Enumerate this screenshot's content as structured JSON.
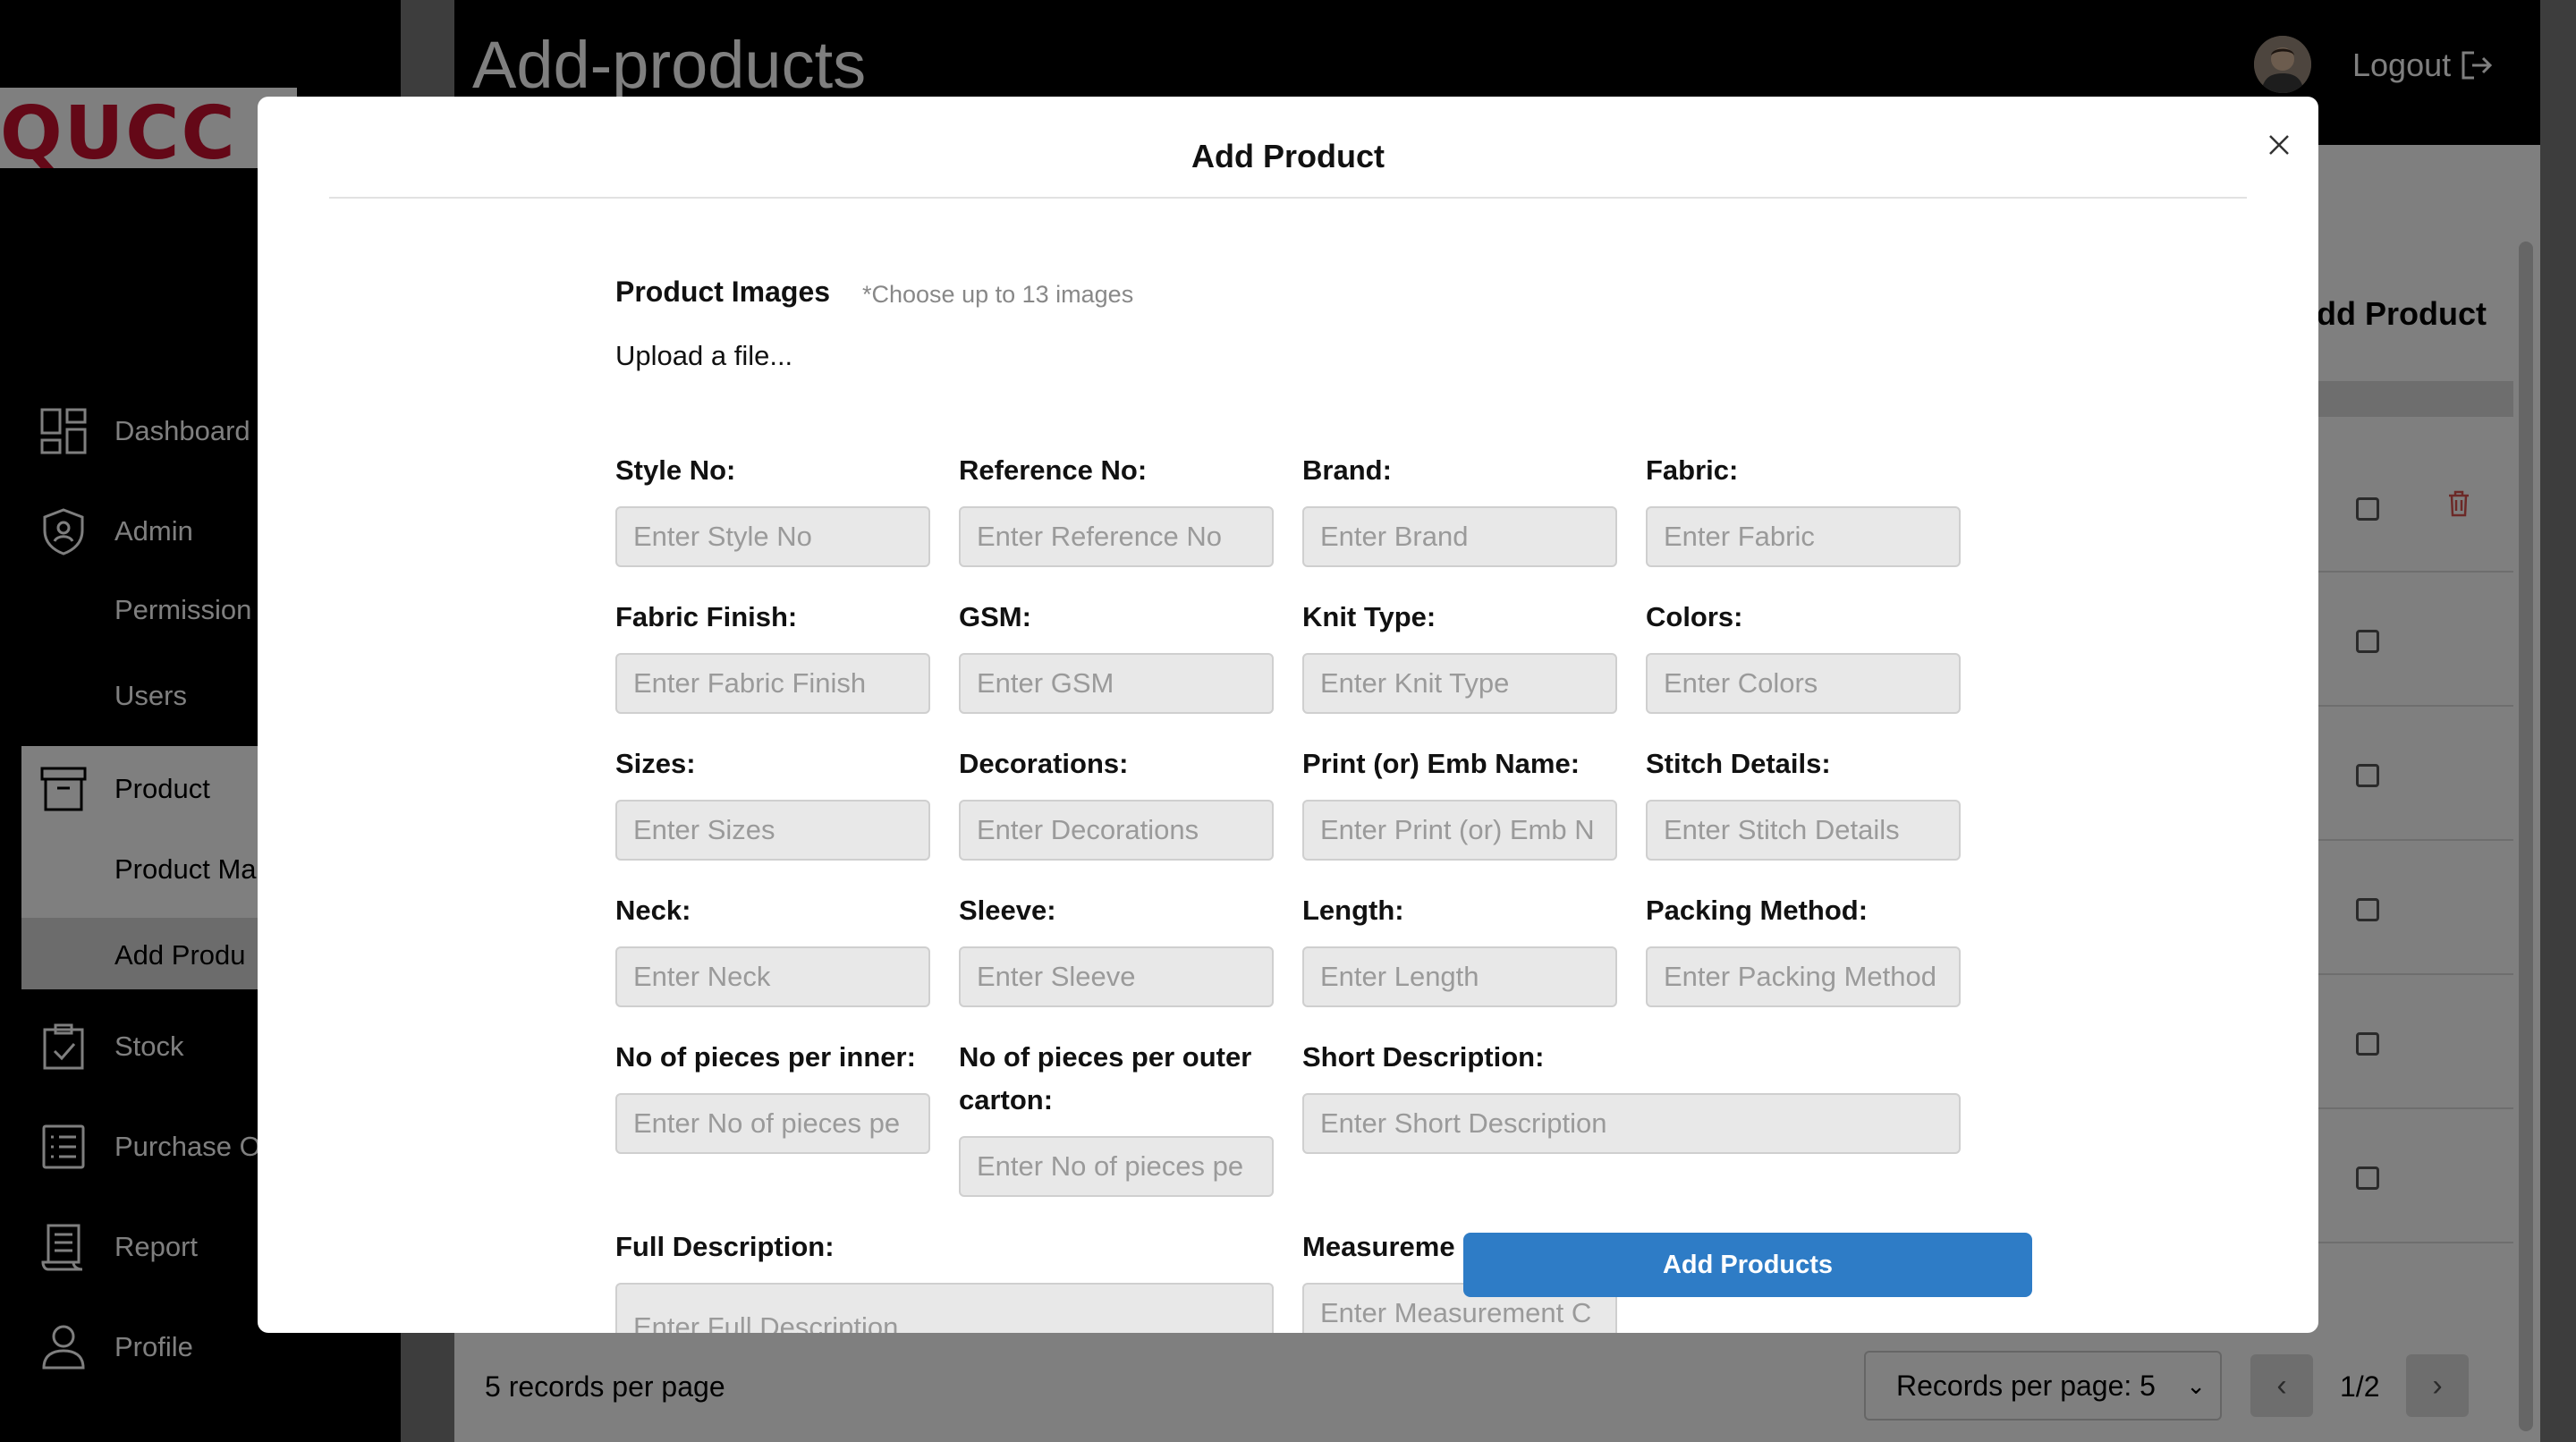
{
  "app": {
    "logo_text": "QUCC",
    "page_title": "Add-products",
    "logout_label": "Logout"
  },
  "sidebar": {
    "items": [
      {
        "label": "Dashboard",
        "icon": "dashboard-icon"
      },
      {
        "label": "Admin",
        "icon": "shield-icon"
      },
      {
        "label": "Permission",
        "icon": ""
      },
      {
        "label": "Users",
        "icon": ""
      },
      {
        "label": "Product",
        "icon": "archive-icon"
      },
      {
        "label": "Product Ma",
        "icon": ""
      },
      {
        "label": "Add Produ",
        "icon": ""
      },
      {
        "label": "Stock",
        "icon": "clipboard-check-icon"
      },
      {
        "label": "Purchase O",
        "icon": "list-icon"
      },
      {
        "label": "Report",
        "icon": "receipt-icon"
      },
      {
        "label": "Profile",
        "icon": "user-icon"
      }
    ]
  },
  "background": {
    "panel_title": "dd Product",
    "records_text": "5 records per page",
    "records_select": "Records per page: 5",
    "page_indicator": "1/2"
  },
  "modal": {
    "title": "Add Product",
    "images_label": "Product Images",
    "images_hint": "*Choose up to 13 images",
    "upload_text": "Upload a file...",
    "fields": [
      {
        "label": "Style No:",
        "placeholder": "Enter Style No"
      },
      {
        "label": "Reference No:",
        "placeholder": "Enter Reference No"
      },
      {
        "label": "Brand:",
        "placeholder": "Enter Brand"
      },
      {
        "label": "Fabric:",
        "placeholder": "Enter Fabric"
      },
      {
        "label": "Fabric Finish:",
        "placeholder": "Enter Fabric Finish"
      },
      {
        "label": "GSM:",
        "placeholder": "Enter GSM"
      },
      {
        "label": "Knit Type:",
        "placeholder": "Enter Knit Type"
      },
      {
        "label": "Colors:",
        "placeholder": "Enter Colors"
      },
      {
        "label": "Sizes:",
        "placeholder": "Enter Sizes"
      },
      {
        "label": "Decorations:",
        "placeholder": "Enter Decorations"
      },
      {
        "label": "Print (or) Emb Name:",
        "placeholder": "Enter Print (or) Emb N"
      },
      {
        "label": "Stitch Details:",
        "placeholder": "Enter Stitch Details"
      },
      {
        "label": "Neck:",
        "placeholder": "Enter Neck"
      },
      {
        "label": "Sleeve:",
        "placeholder": "Enter Sleeve"
      },
      {
        "label": "Length:",
        "placeholder": "Enter Length"
      },
      {
        "label": "Packing Method:",
        "placeholder": "Enter Packing Method"
      },
      {
        "label": "No of pieces per inner:",
        "placeholder": "Enter No of pieces pe"
      },
      {
        "label": "No of pieces per outer carton:",
        "placeholder": "Enter No of pieces pe"
      },
      {
        "label": "Short Description:",
        "placeholder": "Enter Short Description"
      },
      {
        "label": "Full Description:",
        "placeholder": "Enter Full Description"
      },
      {
        "label": "Measureme",
        "placeholder": "Enter Measurement C"
      }
    ],
    "submit_label": "Add Products"
  },
  "colors": {
    "accent": "#2e7cc6",
    "logo_red": "#c8102e",
    "delete_red": "#d9534f"
  }
}
